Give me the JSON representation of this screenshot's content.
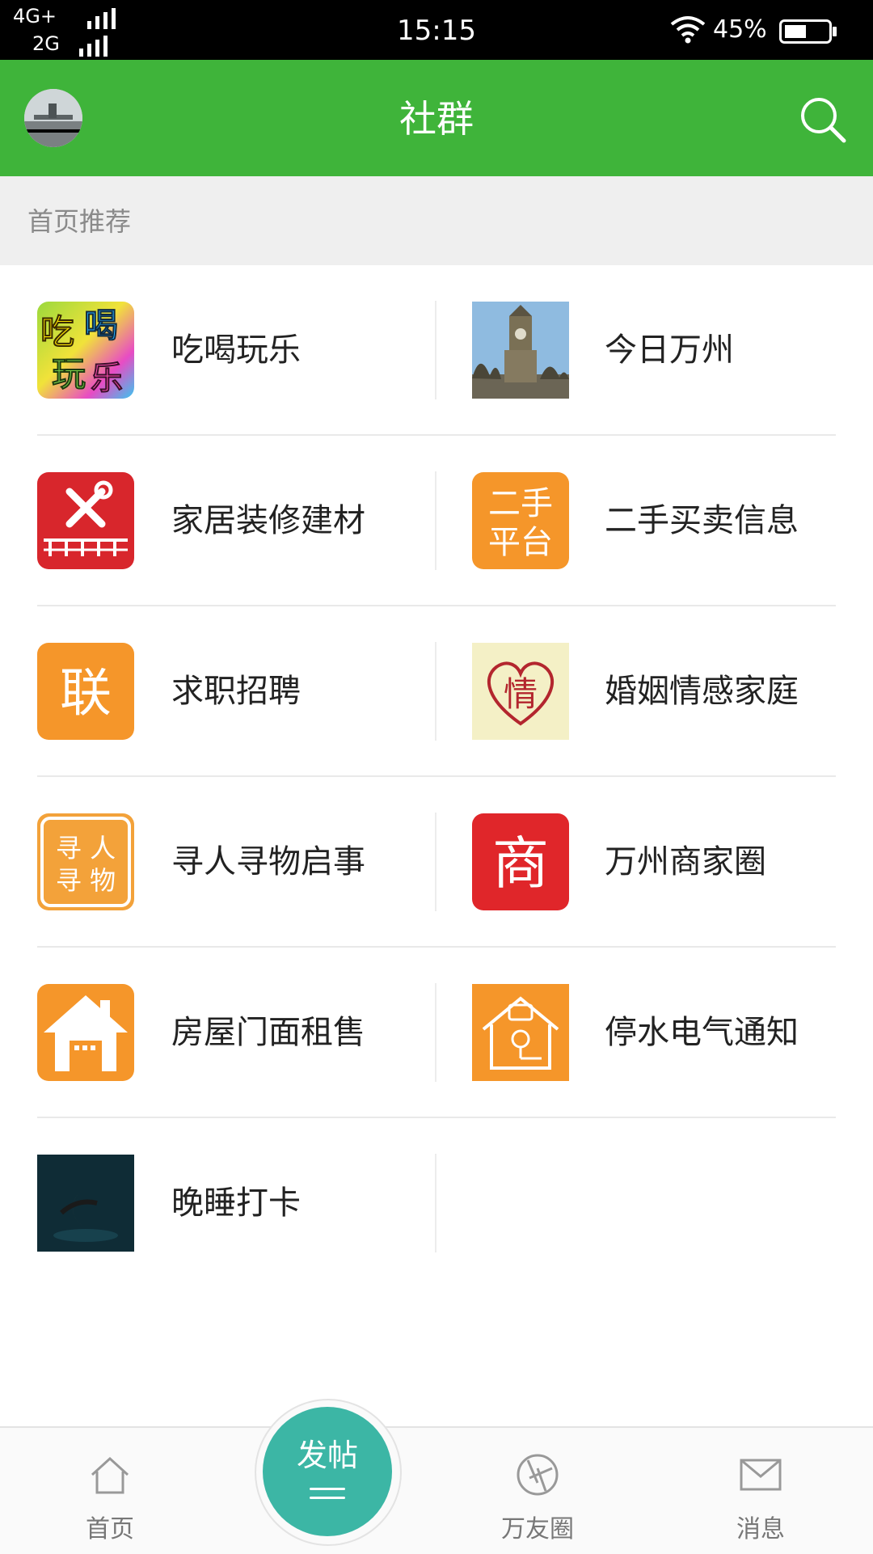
{
  "status_bar": {
    "network_1": "4G+",
    "network_2": "2G",
    "time": "15:15",
    "battery": "45%"
  },
  "header": {
    "title": "社群",
    "search_icon": "search-icon",
    "avatar": "user-avatar"
  },
  "section": {
    "title": "首页推荐"
  },
  "groups": [
    {
      "label": "吃喝玩乐",
      "icon": "food-fun-icon"
    },
    {
      "label": "今日万州",
      "icon": "clock-tower-photo-icon"
    },
    {
      "label": "家居装修建材",
      "icon": "tools-icon"
    },
    {
      "label": "二手买卖信息",
      "icon": "second-hand-icon",
      "icon_text": [
        "二手",
        "平台"
      ]
    },
    {
      "label": "求职招聘",
      "icon": "jobs-icon",
      "icon_text": [
        "联"
      ]
    },
    {
      "label": "婚姻情感家庭",
      "icon": "heart-icon",
      "icon_text": [
        "情"
      ]
    },
    {
      "label": "寻人寻物启事",
      "icon": "lost-found-icon",
      "icon_text": [
        "寻 人",
        "寻 物"
      ]
    },
    {
      "label": "万州商家圈",
      "icon": "merchant-icon",
      "icon_text": [
        "商"
      ]
    },
    {
      "label": "房屋门面租售",
      "icon": "house-icon"
    },
    {
      "label": "停水电气通知",
      "icon": "utility-notice-icon"
    },
    {
      "label": "晚睡打卡",
      "icon": "night-moon-icon"
    }
  ],
  "food_icon_text": [
    "吃",
    "喝",
    "玩",
    "乐"
  ],
  "bottom_nav": {
    "home": "首页",
    "post": "发帖",
    "circle": "万友圈",
    "messages": "消息"
  },
  "colors": {
    "header_green": "#3fb43a",
    "fab_teal": "#3cb6a5",
    "orange": "#f5962a",
    "red": "#d8262c"
  }
}
